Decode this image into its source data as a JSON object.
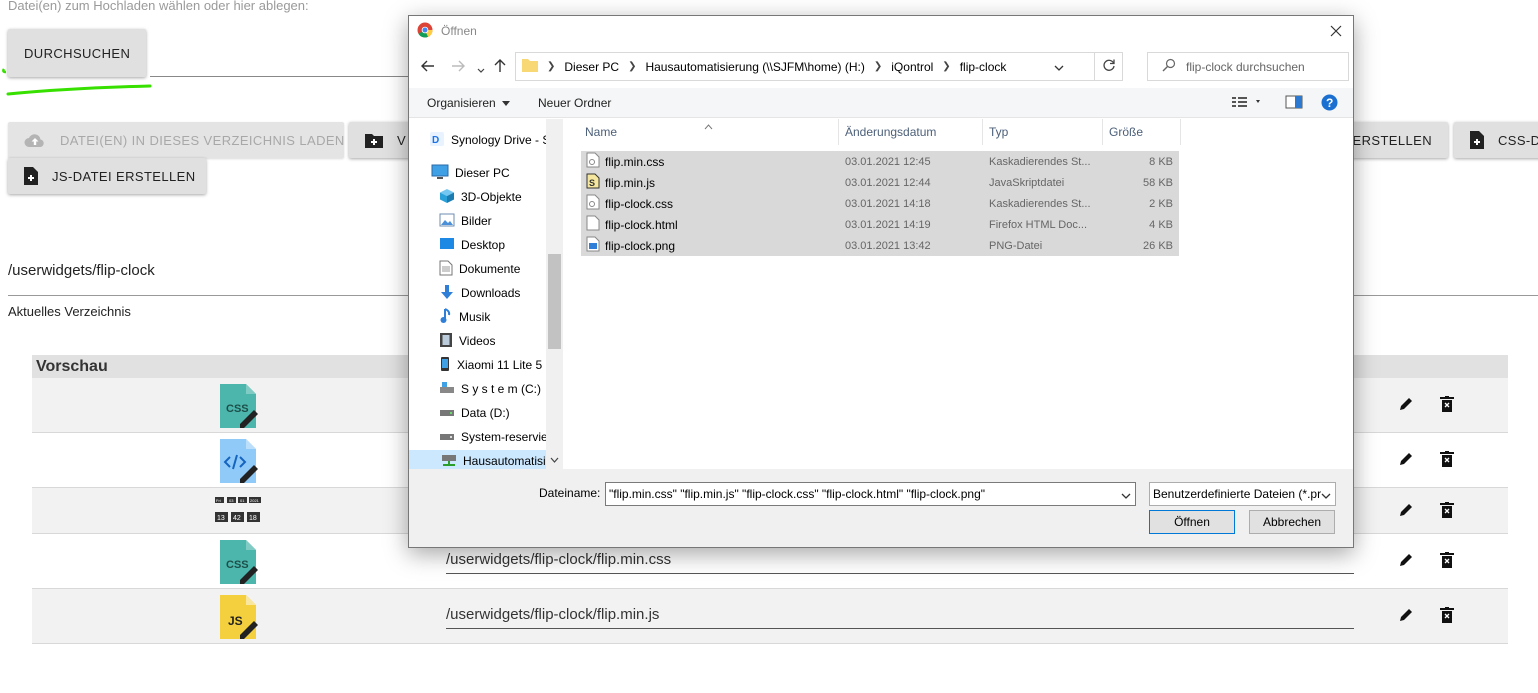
{
  "page": {
    "upload_label": "Datei(en) zum Hochladen wählen oder hier ablegen:",
    "browse_button": "DURCHSUCHEN",
    "load_dir_button": "DATEI(EN) IN DIESES VERZEICHNIS LADEN",
    "new_button_partial": "V",
    "create_button_partial": "I ERSTELLEN",
    "css_button_partial": "CSS-D",
    "js_button": "JS-DATEI ERSTELLEN",
    "path": "/userwidgets/flip-clock",
    "current_dir_label": "Aktuelles Verzeichnis",
    "preview_header": "Vorschau",
    "rows": [
      {
        "thumb": "css-file-icon",
        "path": ""
      },
      {
        "thumb": "html-file-icon",
        "path": ""
      },
      {
        "thumb": "clock-preview-image",
        "path": ""
      },
      {
        "thumb": "css-file-icon",
        "path": "/userwidgets/flip-clock/flip.min.css"
      },
      {
        "thumb": "js-file-icon",
        "path": "/userwidgets/flip-clock/flip.min.js"
      }
    ],
    "clock_preview": {
      "top": [
        "Fri",
        "03",
        "01",
        "2021"
      ],
      "bottom": [
        "13",
        "42",
        "18"
      ]
    }
  },
  "dialog": {
    "title": "Öffnen",
    "breadcrumbs": [
      "Dieser PC",
      "Hausautomatisierung (\\\\SJFM\\home) (H:)",
      "iQontrol",
      "flip-clock"
    ],
    "search_placeholder": "flip-clock durchsuchen",
    "toolbar": {
      "organize": "Organisieren",
      "new_folder": "Neuer Ordner"
    },
    "nav_items": [
      {
        "label": "Synology Drive - S",
        "icon": "synology-drive-icon"
      },
      {
        "label": "Dieser PC",
        "icon": "computer-icon"
      },
      {
        "label": "3D-Objekte",
        "icon": "3d-objects-icon"
      },
      {
        "label": "Bilder",
        "icon": "pictures-icon"
      },
      {
        "label": "Desktop",
        "icon": "desktop-icon"
      },
      {
        "label": "Dokumente",
        "icon": "documents-icon"
      },
      {
        "label": "Downloads",
        "icon": "downloads-icon"
      },
      {
        "label": "Musik",
        "icon": "music-icon"
      },
      {
        "label": "Videos",
        "icon": "videos-icon"
      },
      {
        "label": "Xiaomi 11 Lite 5",
        "icon": "phone-icon"
      },
      {
        "label": "S y s t e m (C:)",
        "icon": "system-drive-icon"
      },
      {
        "label": "Data (D:)",
        "icon": "drive-icon"
      },
      {
        "label": "System-reservie",
        "icon": "drive-icon"
      },
      {
        "label": "Hausautomatisi",
        "icon": "network-drive-icon"
      }
    ],
    "columns": [
      "Name",
      "Änderungsdatum",
      "Typ",
      "Größe"
    ],
    "files": [
      {
        "name": "flip.min.css",
        "date": "03.01.2021 12:45",
        "type": "Kaskadierendes St...",
        "size": "8 KB",
        "icon": "css-file-icon"
      },
      {
        "name": "flip.min.js",
        "date": "03.01.2021 12:44",
        "type": "JavaSkriptdatei",
        "size": "58 KB",
        "icon": "js-file-icon"
      },
      {
        "name": "flip-clock.css",
        "date": "03.01.2021 14:18",
        "type": "Kaskadierendes St...",
        "size": "2 KB",
        "icon": "css-file-icon"
      },
      {
        "name": "flip-clock.html",
        "date": "03.01.2021 14:19",
        "type": "Firefox HTML Doc...",
        "size": "4 KB",
        "icon": "html-file-icon"
      },
      {
        "name": "flip-clock.png",
        "date": "03.01.2021 13:42",
        "type": "PNG-Datei",
        "size": "26 KB",
        "icon": "png-file-icon"
      }
    ],
    "filename_label": "Dateiname:",
    "filename_value": "\"flip.min.css\" \"flip.min.js\" \"flip-clock.css\" \"flip-clock.html\" \"flip-clock.png\"",
    "filter_value": "Benutzerdefinierte Dateien (*.pr",
    "open_button": "Öffnen",
    "cancel_button": "Abbrechen"
  },
  "colors": {
    "selection": "#d9d9d9",
    "accent": "#0078d7",
    "css_thumb": "#4db6ac",
    "js_thumb": "#f4d03f",
    "html_thumb": "#90caf9",
    "green_mark": "#38e000"
  }
}
